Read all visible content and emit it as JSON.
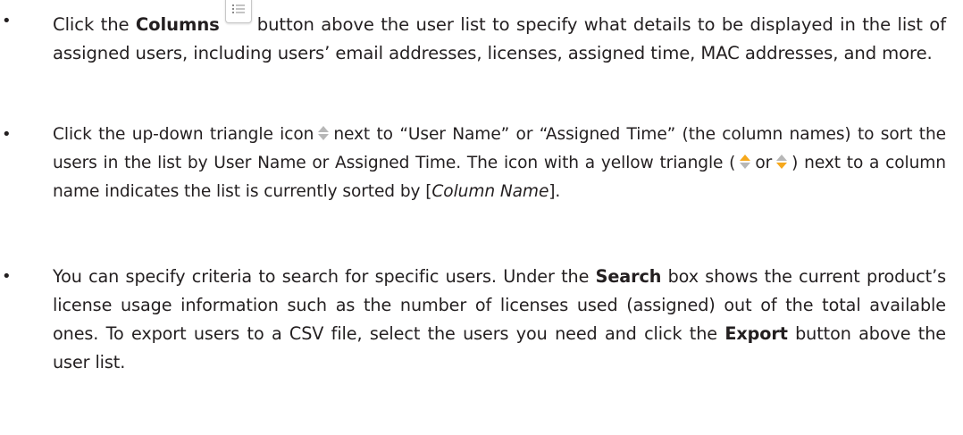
{
  "bullet_glyph": "•",
  "icons": {
    "columns_button": "columns-list-icon",
    "sort_neutral": "sort-updown-gray-icon",
    "sort_up_active": "sort-up-yellow-icon",
    "sort_down_active": "sort-down-yellow-icon"
  },
  "colors": {
    "text": "#231f20",
    "sort_gray": "#b7b7b7",
    "sort_yellow": "#f6a81c"
  },
  "item1": {
    "text_before": "Click the ",
    "columns_bold": "Columns",
    "text_after": "button above the user list to specify what details to be displayed in the list of assigned users, including users’ email addresses, licenses, assigned time, MAC addresses, and more."
  },
  "item2": {
    "text_part1": "Click the up-down triangle icon",
    "text_part2": "next to “User Name” or “Assigned Time” (the column names) to sort the users in the list by User Name or Assigned Time. The icon with a yellow triangle (",
    "text_or": "or",
    "text_part3": ") next to a column name indicates the list is currently sorted by [",
    "column_name_italic": "Column Name",
    "text_end": "]."
  },
  "item3": {
    "text_part1": "You can specify criteria to search for specific users. Under the ",
    "search_bold": "Search",
    "text_part2": " box shows the current product’s license usage information such as the number of licenses used (assigned) out of the total available ones. To export users to a CSV file, select the users you need and click the ",
    "export_bold": "Export",
    "text_part3": " button above the user list."
  }
}
